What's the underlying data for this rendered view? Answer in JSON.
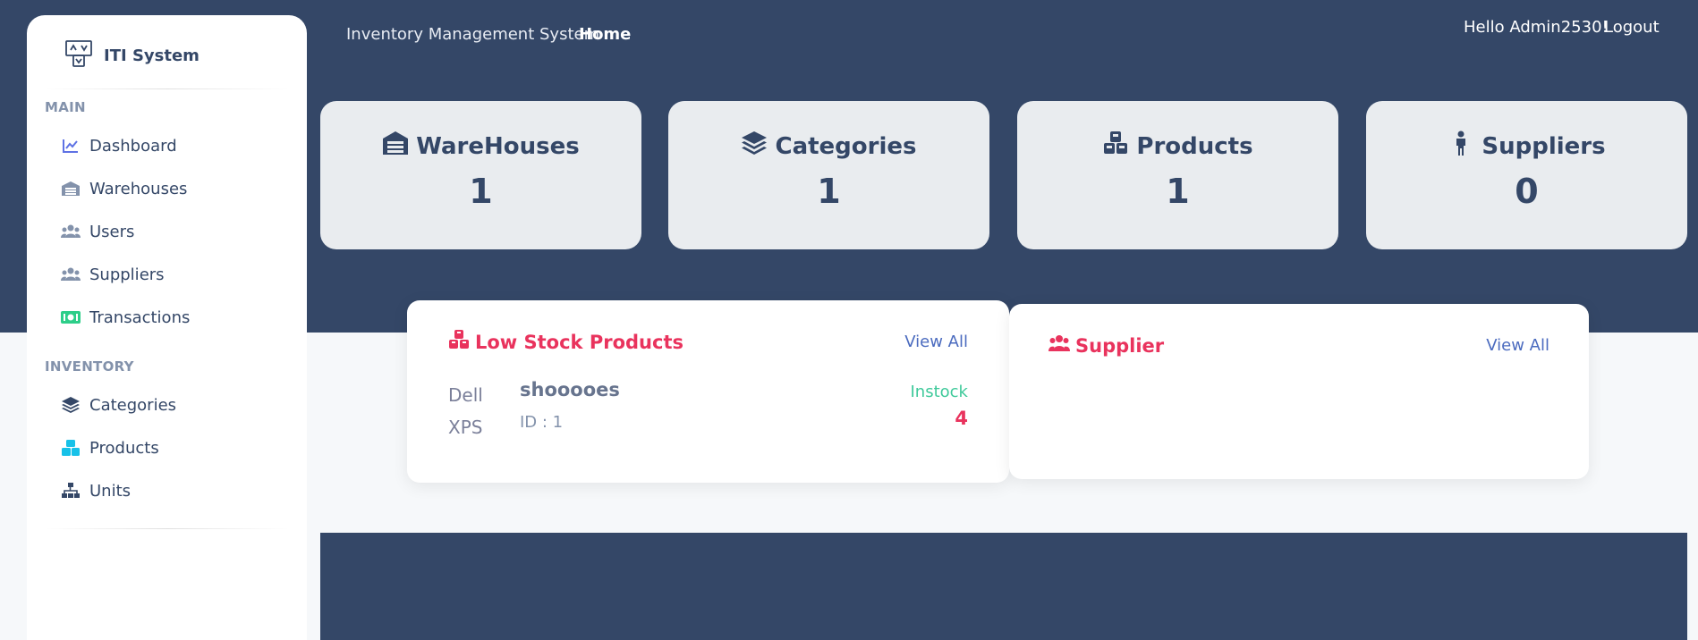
{
  "sidebar": {
    "brand": "ITI System",
    "main_title": "MAIN",
    "inventory_title": "INVENTORY",
    "items": [
      {
        "label": "Dashboard",
        "icon": "chart-line-icon"
      },
      {
        "label": "Warehouses",
        "icon": "warehouse-icon"
      },
      {
        "label": "Users",
        "icon": "users-icon"
      },
      {
        "label": "Suppliers",
        "icon": "users-icon"
      },
      {
        "label": "Transactions",
        "icon": "money-bill-icon"
      },
      {
        "label": "Categories",
        "icon": "layer-group-icon"
      },
      {
        "label": "Products",
        "icon": "cubes-icon"
      },
      {
        "label": "Units",
        "icon": "sitemap-icon"
      }
    ]
  },
  "topnav": {
    "brand": "Inventory Management System",
    "home": "Home",
    "greeting": "Hello Admin2530!",
    "logout": "Logout"
  },
  "stats": [
    {
      "title": "WareHouses",
      "value": "1",
      "icon": "warehouse-icon"
    },
    {
      "title": "Categories",
      "value": "1",
      "icon": "layer-group-icon"
    },
    {
      "title": "Products",
      "value": "1",
      "icon": "cubes-icon"
    },
    {
      "title": "Suppliers",
      "value": "0",
      "icon": "person-icon"
    }
  ],
  "low_stock": {
    "title": "Low Stock Products",
    "view_all": "View All",
    "product": {
      "image_alt": "Dell XPS",
      "name": "shooooes",
      "id": "ID : 1",
      "status": "Instock",
      "qty": "4"
    }
  },
  "supplier_panel": {
    "title": "Supplier",
    "view_all": "View All"
  },
  "colors": {
    "dark": "#344767",
    "accent_red": "#e9335d",
    "link": "#4b6bbf",
    "instock": "#3ec99a"
  }
}
